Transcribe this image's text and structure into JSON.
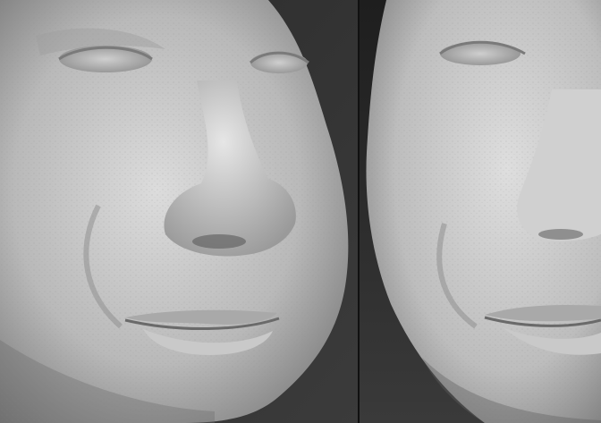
{
  "image": {
    "title": "",
    "panels": [
      {
        "subject": "sculpted-face-front",
        "material": "matte-clay"
      },
      {
        "subject": "sculpted-face-side",
        "material": "matte-clay"
      }
    ],
    "colors": {
      "background_dark": "#1f1f1f",
      "background_mid": "#3a3a3a",
      "clay_light": "#d9d9d9",
      "clay_mid": "#a8a8a8",
      "clay_shadow": "#5c5c5c",
      "divider": "#111111"
    }
  }
}
